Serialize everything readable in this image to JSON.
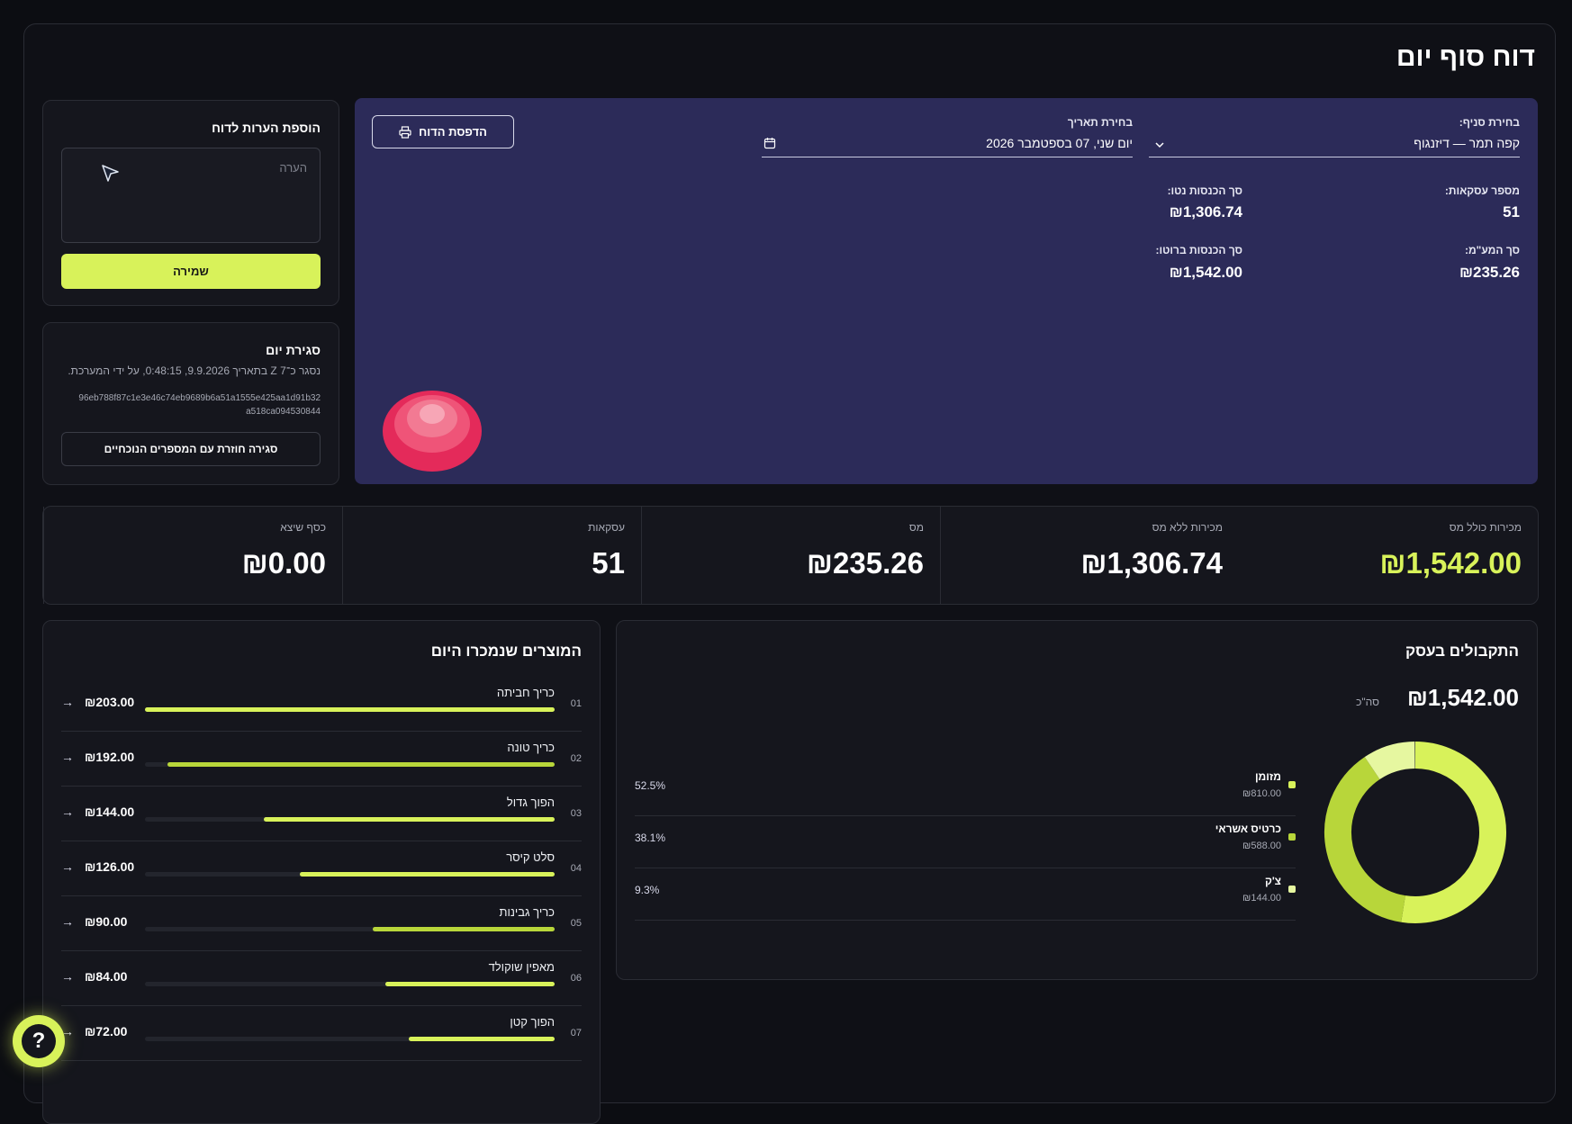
{
  "page": {
    "title": "דוח סוף יום"
  },
  "notes": {
    "title": "הוספת הערות לדוח",
    "placeholder": "הערה",
    "save_label": "שמירה"
  },
  "close_day": {
    "title": "סגירת יום",
    "status": "נסגר כ־Z 7 בתאריך 9.9.2026, 0:48:15, על ידי המערכת.",
    "hash_line1": "96eb788f87c1e3e46c74eb9689b6a51a1555e425aa1d91b32",
    "hash_line2": "a518ca094530844",
    "reclose_label": "סגירה חוזרת עם המספרים הנוכחיים"
  },
  "report": {
    "branch_label": "בחירת סניף:",
    "branch_value": "קפה תמר — דיזנגוף",
    "date_label": "בחירת תאריך",
    "date_value": "יום שני, 07 בספטמבר 2026",
    "print_label": "הדפסת הדוח",
    "transactions_label": "מספר עסקאות:",
    "transactions_value": "51",
    "net_label": "סך הכנסות נטו:",
    "net_value": "₪1,306.74",
    "vat_label": "סך המע\"מ:",
    "vat_value": "₪235.26",
    "gross_label": "סך הכנסות ברוטו:",
    "gross_value": "₪1,542.00"
  },
  "stats": [
    {
      "label": "מכירות כולל מס",
      "value": "₪1,542.00",
      "accent": true
    },
    {
      "label": "מכירות ללא מס",
      "value": "₪1,306.74",
      "accent": false
    },
    {
      "label": "מס",
      "value": "₪235.26",
      "accent": false
    },
    {
      "label": "עסקאות",
      "value": "51",
      "accent": false
    },
    {
      "label": "כסף שיצא",
      "value": "₪0.00",
      "accent": false
    }
  ],
  "products": {
    "title": "המוצרים שנמכרו היום",
    "items": [
      {
        "num": "01",
        "name": "כריך חביתה",
        "amount": "₪203.00",
        "share": 1.0
      },
      {
        "num": "02",
        "name": "כריך טונה",
        "amount": "₪192.00",
        "share": 0.946
      },
      {
        "num": "03",
        "name": "הפוך גדול",
        "amount": "₪144.00",
        "share": 0.709
      },
      {
        "num": "04",
        "name": "סלט קיסר",
        "amount": "₪126.00",
        "share": 0.621
      },
      {
        "num": "05",
        "name": "כריך גבינות",
        "amount": "₪90.00",
        "share": 0.443
      },
      {
        "num": "06",
        "name": "מאפין שוקולד",
        "amount": "₪84.00",
        "share": 0.414
      },
      {
        "num": "07",
        "name": "הפוך קטן",
        "amount": "₪72.00",
        "share": 0.355
      }
    ]
  },
  "payments": {
    "title": "התקבולים בעסק",
    "total": "₪1,542.00",
    "total_label": "סה\"כ",
    "items": [
      {
        "name": "מזומן",
        "amount": "₪810.00",
        "percent": "52.5%",
        "share": 0.525,
        "color": "#d8f25a"
      },
      {
        "name": "כרטיס אשראי",
        "amount": "₪588.00",
        "percent": "38.1%",
        "share": 0.381,
        "color": "#b8d63a"
      },
      {
        "name": "צ'ק",
        "amount": "₪144.00",
        "percent": "9.3%",
        "share": 0.093,
        "color": "#e6f7a0"
      }
    ]
  },
  "colors": {
    "accent": "#d8f25a",
    "panel": "#2c2b59",
    "bg": "#0c0d12"
  }
}
